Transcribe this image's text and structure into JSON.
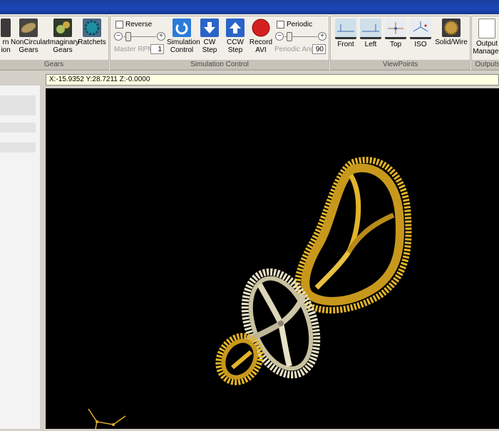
{
  "ribbon": {
    "groups": {
      "gears": {
        "caption": "Gears"
      },
      "simulation": {
        "caption": "Simulation Control"
      },
      "viewpoints": {
        "caption": "ViewPoints"
      },
      "outputs": {
        "caption": "Outputs"
      }
    },
    "gears_tools": [
      {
        "label1": "rn",
        "label2": "ion",
        "icon": "worm-gear-icon"
      },
      {
        "label1": "NonCircular",
        "label2": "Gears",
        "icon": "noncircular-gear-icon"
      },
      {
        "label1": "Imaginary",
        "label2": "Gears",
        "icon": "imaginary-gear-icon"
      },
      {
        "label1": "Ratchets",
        "label2": "",
        "icon": "ratchet-icon"
      }
    ],
    "simulation": {
      "reverse_label": "Reverse",
      "master_rpm_label": "Master RPM",
      "master_rpm_value": "1",
      "tools": [
        {
          "label1": "Simulation",
          "label2": "Control",
          "icon": "simulation-control-icon",
          "color": "#2b7bd8"
        },
        {
          "label1": "CW",
          "label2": "Step",
          "icon": "cw-step-icon",
          "color": "#2a64c8"
        },
        {
          "label1": "CCW",
          "label2": "Step",
          "icon": "ccw-step-icon",
          "color": "#2a64c8"
        },
        {
          "label1": "Record",
          "label2": "AVI",
          "icon": "record-icon",
          "color": "#d42020"
        }
      ],
      "periodic_label": "Periodic",
      "periodic_ang_label": "Periodic Ang",
      "periodic_ang_value": "90"
    },
    "viewpoints": [
      {
        "label": "Front",
        "icon": "front-view-icon"
      },
      {
        "label": "Left",
        "icon": "left-view-icon"
      },
      {
        "label": "Top",
        "icon": "top-view-icon"
      },
      {
        "label": "ISO",
        "icon": "iso-view-icon"
      },
      {
        "label": "Solid/Wire",
        "icon": "solid-wire-icon"
      }
    ],
    "outputs": [
      {
        "label1": "Output",
        "label2": "Manager",
        "icon": "output-manager-icon"
      }
    ]
  },
  "coords": {
    "text": "X:-15.9352 Y:28.7211 Z:-0.0000"
  },
  "viewport": {
    "background": "#000000",
    "gear_color": "#e2b428",
    "gear_shadow": "#a87a10",
    "pale_gear_color": "#e8e2c6"
  }
}
